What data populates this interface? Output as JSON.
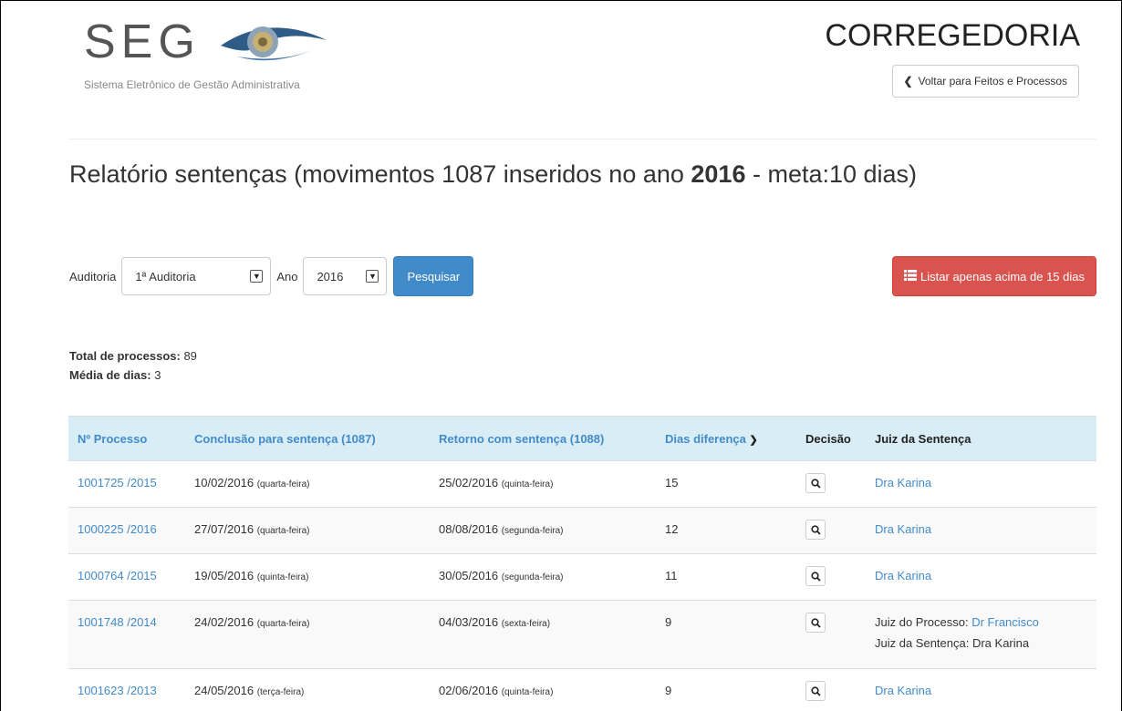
{
  "header": {
    "logo_text": "SEG",
    "logo_subtitle": "Sistema Eletrônico de Gestão Administrativa",
    "section_title": "CORREGEDORIA",
    "back_button_label": "Voltar para Feitos e Processos"
  },
  "report": {
    "title_prefix": "Relatório sentenças (movimentos 1087 inseridos no ano ",
    "title_year": "2016",
    "title_suffix": " - meta:10 dias)"
  },
  "filters": {
    "auditoria_label": "Auditoria",
    "auditoria_value": "1ª Auditoria",
    "ano_label": "Ano",
    "ano_value": "2016",
    "search_button": "Pesquisar",
    "list_button": "Listar apenas acima de 15 dias"
  },
  "totals": {
    "total_label": "Total de processos:",
    "total_value": " 89",
    "media_label": "Média de dias:",
    "media_value": " 3"
  },
  "table": {
    "headers": {
      "processo": "Nº Processo",
      "conclusao": "Conclusão para sentença (1087)",
      "retorno": "Retorno com sentença (1088)",
      "dias": "Dias diferença",
      "decisao": "Decisão",
      "juiz": "Juiz da Sentença"
    },
    "rows": [
      {
        "processo": "1001725 /2015",
        "conclusao_date": "10/02/2016",
        "conclusao_day": "(quarta-feira)",
        "retorno_date": "25/02/2016",
        "retorno_day": "(quinta-feira)",
        "dias": "15",
        "juiz": "Dra Karina"
      },
      {
        "processo": "1000225 /2016",
        "conclusao_date": "27/07/2016",
        "conclusao_day": "(quarta-feira)",
        "retorno_date": "08/08/2016",
        "retorno_day": "(segunda-feira)",
        "dias": "12",
        "juiz": "Dra Karina"
      },
      {
        "processo": "1000764 /2015",
        "conclusao_date": "19/05/2016",
        "conclusao_day": "(quinta-feira)",
        "retorno_date": "30/05/2016",
        "retorno_day": "(segunda-feira)",
        "dias": "11",
        "juiz": "Dra Karina"
      },
      {
        "processo": "1001748 /2014",
        "conclusao_date": "24/02/2016",
        "conclusao_day": "(quarta-feira)",
        "retorno_date": "04/03/2016",
        "retorno_day": "(sexta-feira)",
        "dias": "9",
        "juiz_processo_label": "Juiz do Processo: ",
        "juiz_processo": "Dr Francisco",
        "juiz_sentenca_label": "Juiz da Sentença: ",
        "juiz_sentenca": "Dra Karina"
      },
      {
        "processo": "1001623 /2013",
        "conclusao_date": "24/05/2016",
        "conclusao_day": "(terça-feira)",
        "retorno_date": "02/06/2016",
        "retorno_day": "(quinta-feira)",
        "dias": "9",
        "juiz": "Dra Karina"
      }
    ]
  }
}
